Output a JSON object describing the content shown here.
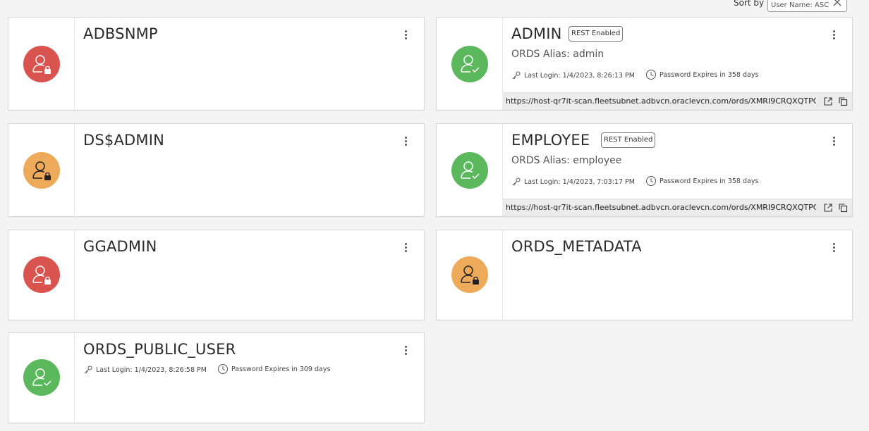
{
  "sort": {
    "label": "Sort by",
    "value": "User Name: ASC"
  },
  "colors": {
    "locked_red": "#d9534f",
    "locked_orange": "#eeaa5b",
    "active_green": "#5cb85c"
  },
  "users": [
    {
      "name": "ADBSNMP",
      "status_icon": "user-locked-icon",
      "avatar_color": "#d9534f"
    },
    {
      "name": "ADMIN",
      "badge": "REST Enabled",
      "alias": "ORDS Alias: admin",
      "last_login": "Last Login: 1/4/2023, 8:26:13 PM",
      "password_expires": "Password Expires in 358 days",
      "url": "https://host-qr7it-scan.fleetsubnet.adbvcn.oraclevcn.com/ords/XMRI9CRQXQTPC...",
      "status_icon": "user-check-icon",
      "avatar_color": "#5cb85c"
    },
    {
      "name": "DS$ADMIN",
      "status_icon": "user-locked-icon",
      "avatar_color": "#eeaa5b"
    },
    {
      "name": "EMPLOYEE",
      "badge": "REST Enabled",
      "alias": "ORDS Alias: employee",
      "last_login": "Last Login: 1/4/2023, 7:03:17 PM",
      "password_expires": "Password Expires in 358 days",
      "url": "https://host-qr7it-scan.fleetsubnet.adbvcn.oraclevcn.com/ords/XMRI9CRQXQTPC...",
      "status_icon": "user-check-icon",
      "avatar_color": "#5cb85c"
    },
    {
      "name": "GGADMIN",
      "status_icon": "user-locked-icon",
      "avatar_color": "#d9534f"
    },
    {
      "name": "ORDS_METADATA",
      "status_icon": "user-locked-icon",
      "avatar_color": "#eeaa5b"
    },
    {
      "name": "ORDS_PUBLIC_USER",
      "last_login": "Last Login: 1/4/2023, 8:26:58 PM",
      "password_expires": "Password Expires in 309 days",
      "status_icon": "user-check-icon",
      "avatar_color": "#5cb85c"
    }
  ]
}
